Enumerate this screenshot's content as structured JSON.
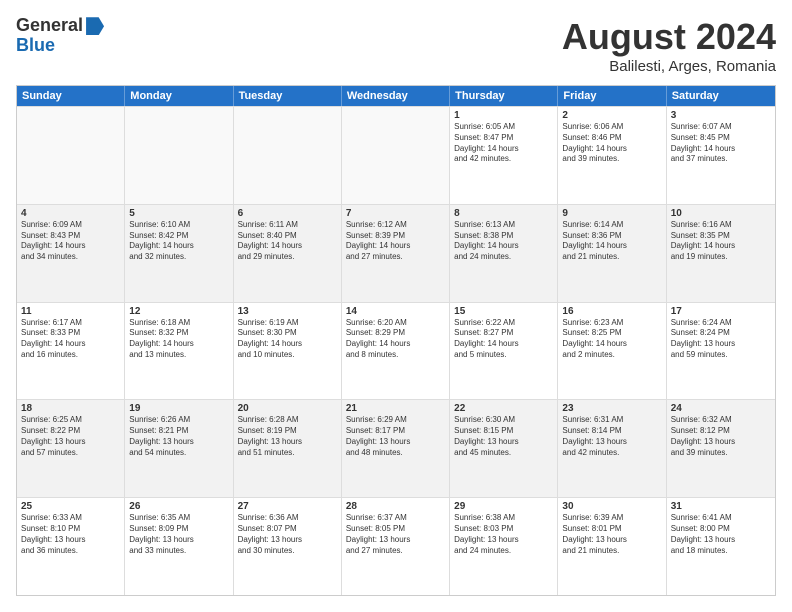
{
  "header": {
    "logo_general": "General",
    "logo_blue": "Blue",
    "main_title": "August 2024",
    "subtitle": "Balilesti, Arges, Romania"
  },
  "calendar": {
    "days": [
      "Sunday",
      "Monday",
      "Tuesday",
      "Wednesday",
      "Thursday",
      "Friday",
      "Saturday"
    ],
    "rows": [
      [
        {
          "day": "",
          "empty": true
        },
        {
          "day": "",
          "empty": true
        },
        {
          "day": "",
          "empty": true
        },
        {
          "day": "",
          "empty": true
        },
        {
          "day": "1",
          "lines": [
            "Sunrise: 6:05 AM",
            "Sunset: 8:47 PM",
            "Daylight: 14 hours",
            "and 42 minutes."
          ]
        },
        {
          "day": "2",
          "lines": [
            "Sunrise: 6:06 AM",
            "Sunset: 8:46 PM",
            "Daylight: 14 hours",
            "and 39 minutes."
          ]
        },
        {
          "day": "3",
          "lines": [
            "Sunrise: 6:07 AM",
            "Sunset: 8:45 PM",
            "Daylight: 14 hours",
            "and 37 minutes."
          ]
        }
      ],
      [
        {
          "day": "4",
          "lines": [
            "Sunrise: 6:09 AM",
            "Sunset: 8:43 PM",
            "Daylight: 14 hours",
            "and 34 minutes."
          ]
        },
        {
          "day": "5",
          "lines": [
            "Sunrise: 6:10 AM",
            "Sunset: 8:42 PM",
            "Daylight: 14 hours",
            "and 32 minutes."
          ]
        },
        {
          "day": "6",
          "lines": [
            "Sunrise: 6:11 AM",
            "Sunset: 8:40 PM",
            "Daylight: 14 hours",
            "and 29 minutes."
          ]
        },
        {
          "day": "7",
          "lines": [
            "Sunrise: 6:12 AM",
            "Sunset: 8:39 PM",
            "Daylight: 14 hours",
            "and 27 minutes."
          ]
        },
        {
          "day": "8",
          "lines": [
            "Sunrise: 6:13 AM",
            "Sunset: 8:38 PM",
            "Daylight: 14 hours",
            "and 24 minutes."
          ]
        },
        {
          "day": "9",
          "lines": [
            "Sunrise: 6:14 AM",
            "Sunset: 8:36 PM",
            "Daylight: 14 hours",
            "and 21 minutes."
          ]
        },
        {
          "day": "10",
          "lines": [
            "Sunrise: 6:16 AM",
            "Sunset: 8:35 PM",
            "Daylight: 14 hours",
            "and 19 minutes."
          ]
        }
      ],
      [
        {
          "day": "11",
          "lines": [
            "Sunrise: 6:17 AM",
            "Sunset: 8:33 PM",
            "Daylight: 14 hours",
            "and 16 minutes."
          ]
        },
        {
          "day": "12",
          "lines": [
            "Sunrise: 6:18 AM",
            "Sunset: 8:32 PM",
            "Daylight: 14 hours",
            "and 13 minutes."
          ]
        },
        {
          "day": "13",
          "lines": [
            "Sunrise: 6:19 AM",
            "Sunset: 8:30 PM",
            "Daylight: 14 hours",
            "and 10 minutes."
          ]
        },
        {
          "day": "14",
          "lines": [
            "Sunrise: 6:20 AM",
            "Sunset: 8:29 PM",
            "Daylight: 14 hours",
            "and 8 minutes."
          ]
        },
        {
          "day": "15",
          "lines": [
            "Sunrise: 6:22 AM",
            "Sunset: 8:27 PM",
            "Daylight: 14 hours",
            "and 5 minutes."
          ]
        },
        {
          "day": "16",
          "lines": [
            "Sunrise: 6:23 AM",
            "Sunset: 8:25 PM",
            "Daylight: 14 hours",
            "and 2 minutes."
          ]
        },
        {
          "day": "17",
          "lines": [
            "Sunrise: 6:24 AM",
            "Sunset: 8:24 PM",
            "Daylight: 13 hours",
            "and 59 minutes."
          ]
        }
      ],
      [
        {
          "day": "18",
          "lines": [
            "Sunrise: 6:25 AM",
            "Sunset: 8:22 PM",
            "Daylight: 13 hours",
            "and 57 minutes."
          ]
        },
        {
          "day": "19",
          "lines": [
            "Sunrise: 6:26 AM",
            "Sunset: 8:21 PM",
            "Daylight: 13 hours",
            "and 54 minutes."
          ]
        },
        {
          "day": "20",
          "lines": [
            "Sunrise: 6:28 AM",
            "Sunset: 8:19 PM",
            "Daylight: 13 hours",
            "and 51 minutes."
          ]
        },
        {
          "day": "21",
          "lines": [
            "Sunrise: 6:29 AM",
            "Sunset: 8:17 PM",
            "Daylight: 13 hours",
            "and 48 minutes."
          ]
        },
        {
          "day": "22",
          "lines": [
            "Sunrise: 6:30 AM",
            "Sunset: 8:15 PM",
            "Daylight: 13 hours",
            "and 45 minutes."
          ]
        },
        {
          "day": "23",
          "lines": [
            "Sunrise: 6:31 AM",
            "Sunset: 8:14 PM",
            "Daylight: 13 hours",
            "and 42 minutes."
          ]
        },
        {
          "day": "24",
          "lines": [
            "Sunrise: 6:32 AM",
            "Sunset: 8:12 PM",
            "Daylight: 13 hours",
            "and 39 minutes."
          ]
        }
      ],
      [
        {
          "day": "25",
          "lines": [
            "Sunrise: 6:33 AM",
            "Sunset: 8:10 PM",
            "Daylight: 13 hours",
            "and 36 minutes."
          ]
        },
        {
          "day": "26",
          "lines": [
            "Sunrise: 6:35 AM",
            "Sunset: 8:09 PM",
            "Daylight: 13 hours",
            "and 33 minutes."
          ]
        },
        {
          "day": "27",
          "lines": [
            "Sunrise: 6:36 AM",
            "Sunset: 8:07 PM",
            "Daylight: 13 hours",
            "and 30 minutes."
          ]
        },
        {
          "day": "28",
          "lines": [
            "Sunrise: 6:37 AM",
            "Sunset: 8:05 PM",
            "Daylight: 13 hours",
            "and 27 minutes."
          ]
        },
        {
          "day": "29",
          "lines": [
            "Sunrise: 6:38 AM",
            "Sunset: 8:03 PM",
            "Daylight: 13 hours",
            "and 24 minutes."
          ]
        },
        {
          "day": "30",
          "lines": [
            "Sunrise: 6:39 AM",
            "Sunset: 8:01 PM",
            "Daylight: 13 hours",
            "and 21 minutes."
          ]
        },
        {
          "day": "31",
          "lines": [
            "Sunrise: 6:41 AM",
            "Sunset: 8:00 PM",
            "Daylight: 13 hours",
            "and 18 minutes."
          ]
        }
      ]
    ]
  }
}
